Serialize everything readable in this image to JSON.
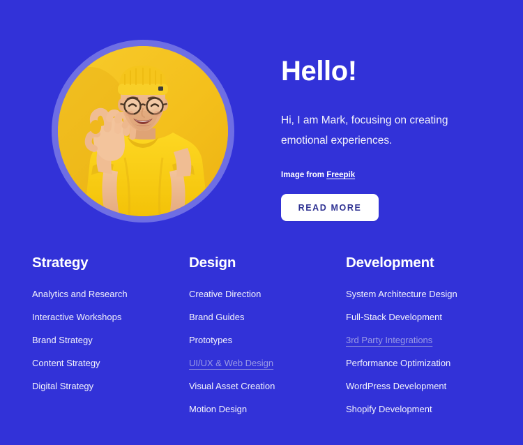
{
  "theme": {
    "background": "#3232d8",
    "ring": "#6e6ee4",
    "photo_background": "#f5c220",
    "text": "#ffffff",
    "muted_link": "#9a9ae5",
    "button_background": "#ffffff",
    "button_text": "#2e3192"
  },
  "hero": {
    "avatar_alt": "Smiling man in yellow beanie and yellow t-shirt making an OK hand gesture on a yellow background",
    "title": "Hello!",
    "subtitle": "Hi, I am Mark, focusing on creating emotional experiences.",
    "credit_prefix": "Image from ",
    "credit_link": "Freepik",
    "cta_label": "READ MORE"
  },
  "columns": [
    {
      "title": "Strategy",
      "items": [
        {
          "label": "Analytics and Research",
          "muted": false
        },
        {
          "label": "Interactive Workshops",
          "muted": false
        },
        {
          "label": "Brand Strategy",
          "muted": false
        },
        {
          "label": "Content Strategy",
          "muted": false
        },
        {
          "label": "Digital Strategy",
          "muted": false
        }
      ]
    },
    {
      "title": "Design",
      "items": [
        {
          "label": "Creative Direction",
          "muted": false
        },
        {
          "label": "Brand Guides",
          "muted": false
        },
        {
          "label": "Prototypes",
          "muted": false
        },
        {
          "label": "UI/UX & Web Design",
          "muted": true
        },
        {
          "label": "Visual Asset Creation",
          "muted": false
        },
        {
          "label": "Motion Design",
          "muted": false
        }
      ]
    },
    {
      "title": "Development",
      "items": [
        {
          "label": "System Architecture Design",
          "muted": false
        },
        {
          "label": "Full-Stack Development",
          "muted": false
        },
        {
          "label": "3rd Party Integrations",
          "muted": true
        },
        {
          "label": "Performance Optimization",
          "muted": false
        },
        {
          "label": "WordPress Development",
          "muted": false
        },
        {
          "label": "Shopify Development",
          "muted": false
        }
      ]
    }
  ]
}
